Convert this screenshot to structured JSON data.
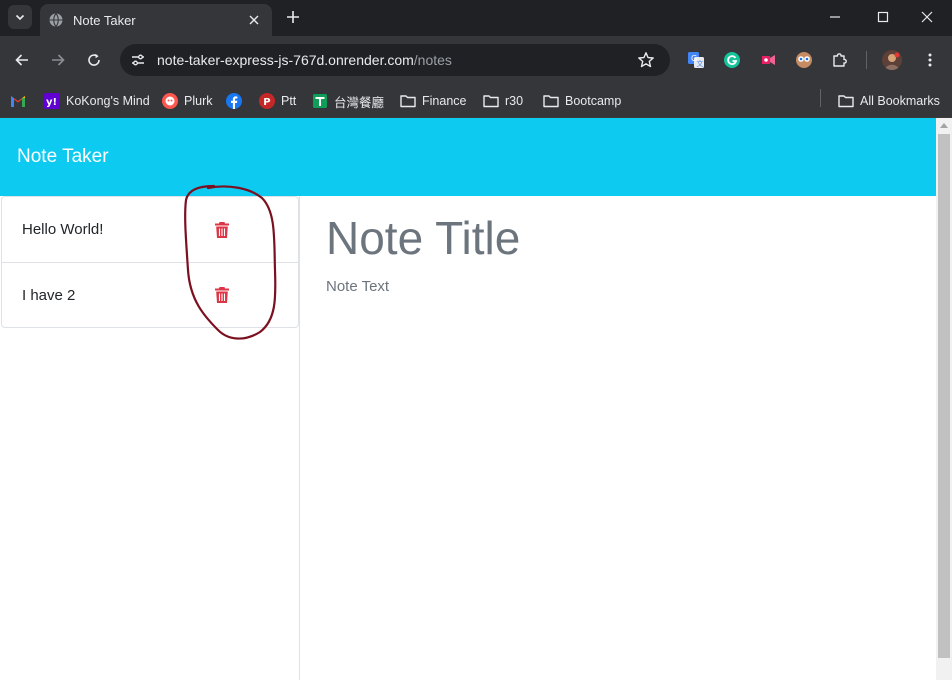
{
  "browser": {
    "tab": {
      "title": "Note Taker",
      "favicon": "globe-icon",
      "close_icon": "close-icon"
    },
    "new_tab_icon": "plus-icon",
    "window_controls": [
      "minimize-icon",
      "maximize-icon",
      "close-icon"
    ],
    "url": {
      "host": "note-taker-express-js-767d.onrender.com",
      "path": "/notes"
    },
    "extensions": [
      "google-translate-icon",
      "grammarly-icon",
      "screen-recorder-icon",
      "eyes-extension-icon",
      "puzzle-icon",
      "profile-avatar",
      "more-vert-icon"
    ],
    "bookmarks": [
      {
        "label": "",
        "icon": "gmail-icon"
      },
      {
        "label": "KoKong's Mind",
        "icon": "yahoo-icon"
      },
      {
        "label": "Plurk",
        "icon": "plurk-icon"
      },
      {
        "label": "",
        "icon": "facebook-icon"
      },
      {
        "label": "Ptt",
        "icon": "ptt-icon"
      },
      {
        "label": "台灣餐廳",
        "icon": "sheets-icon"
      },
      {
        "label": "Finance",
        "icon": "folder-icon"
      },
      {
        "label": "r30",
        "icon": "folder-icon"
      },
      {
        "label": "Bootcamp",
        "icon": "folder-icon"
      },
      {
        "label": "All Bookmarks",
        "icon": "folder-icon"
      }
    ]
  },
  "app": {
    "brand": "Note Taker",
    "notes": [
      {
        "title": "Hello World!"
      },
      {
        "title": "I have 2"
      }
    ],
    "editor": {
      "title_placeholder": "Note Title",
      "text_placeholder": "Note Text"
    }
  },
  "colors": {
    "navbar": "#0dcaf0",
    "delete_icon": "#dc3545",
    "annotation": "#7b1020"
  }
}
